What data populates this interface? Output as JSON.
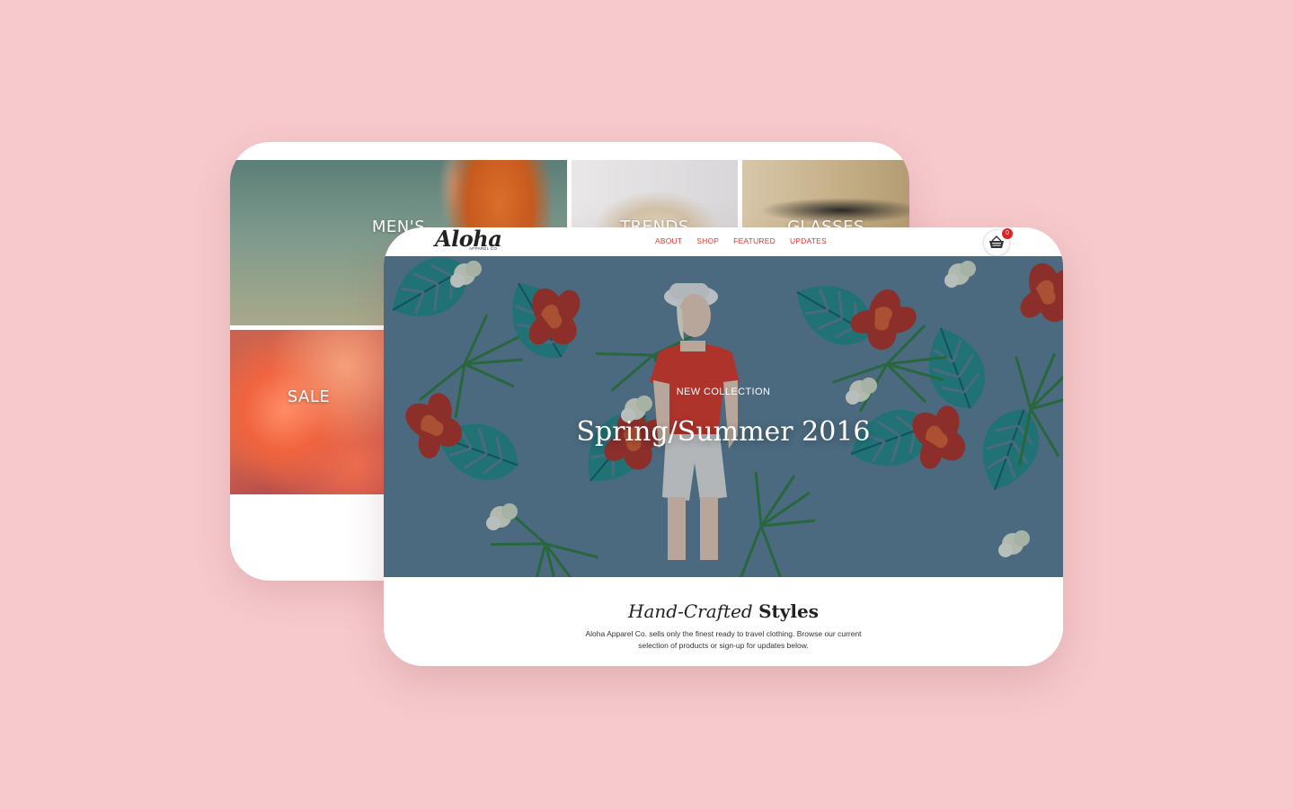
{
  "back_card": {
    "tiles": [
      {
        "label": "MEN'S"
      },
      {
        "label": "TRENDS"
      },
      {
        "label": "GLASSES"
      },
      {
        "label": "SALE"
      }
    ]
  },
  "front_card": {
    "logo": {
      "script": "Aloha",
      "sub": "APPAREL CO."
    },
    "nav": [
      {
        "label": "ABOUT"
      },
      {
        "label": "SHOP"
      },
      {
        "label": "FEATURED"
      },
      {
        "label": "UPDATES"
      }
    ],
    "cart": {
      "icon": "basket-icon",
      "count": "0"
    },
    "hero": {
      "kicker": "NEW COLLECTION",
      "title": "Spring/Summer 2016"
    },
    "intro": {
      "heading_italic": "Hand-Crafted",
      "heading_bold": "Styles",
      "text": "Aloha Apparel Co. sells only the finest ready to travel clothing. Browse our current selection of products or sign-up for updates below."
    }
  },
  "colors": {
    "background": "#f6c9cc",
    "nav_link": "#e0392d",
    "badge": "#e02222",
    "hero_base": "#5b7f93"
  }
}
